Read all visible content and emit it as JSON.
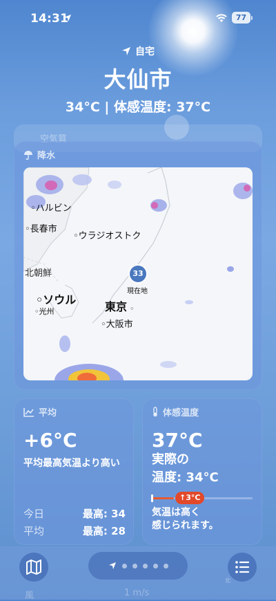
{
  "status_bar": {
    "time": "14:31",
    "battery": "77"
  },
  "header": {
    "location_label": "自宅",
    "city": "大仙市",
    "summary": "34°C | 体感温度: 37°C"
  },
  "air_quality": {
    "title": "空気質"
  },
  "precipitation": {
    "title": "降水",
    "map_labels": {
      "harbin": "ハルビン",
      "changchun": "長春市",
      "vladivostok": "ウラジオストク",
      "north_korea": "北朝鮮",
      "seoul": "ソウル",
      "gwangju": "光州",
      "tokyo": "東京",
      "osaka": "大阪市",
      "current": "現在地",
      "current_temp": "33"
    }
  },
  "average": {
    "title": "平均",
    "value": "+6°C",
    "description": "平均最高気温より高い",
    "rows": [
      {
        "label": "今日",
        "value": "最高: 34"
      },
      {
        "label": "平均",
        "value": "最高: 28"
      }
    ]
  },
  "feels_like": {
    "title": "体感温度",
    "value": "37°C",
    "line1": "実際の",
    "line2": "温度: 34°C",
    "delta_badge": "↑3°C",
    "delta_fraction": 0.22,
    "note_line1": "気温は高く",
    "note_line2": "感じられます。"
  },
  "bottom_bar": {
    "wind_peek": "風",
    "wind_speed": "1 m/s",
    "north": "北",
    "page_count": 5
  }
}
